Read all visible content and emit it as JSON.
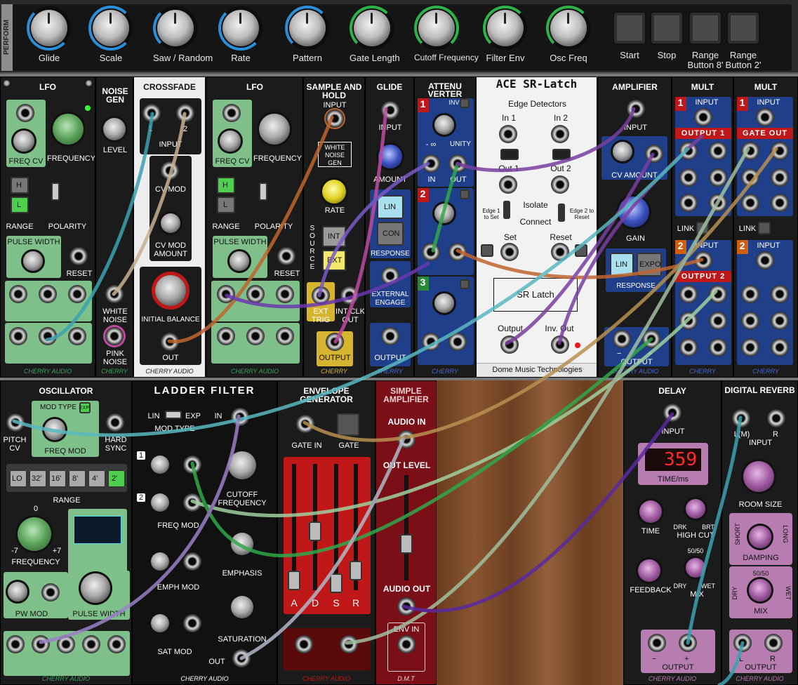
{
  "perform": {
    "tab_label": "PERFORM",
    "knobs": [
      {
        "label": "Glide",
        "color": "#2a8fd8"
      },
      {
        "label": "Scale",
        "color": "#2a8fd8"
      },
      {
        "label": "Saw / Random",
        "color": "#2a8fd8"
      },
      {
        "label": "Rate",
        "color": "#2a8fd8"
      },
      {
        "label": "Pattern",
        "color": "#2a8fd8"
      },
      {
        "label": "Gate Length",
        "color": "#2db34a"
      },
      {
        "label": "Cutoff Frequency",
        "color": "#2db34a"
      },
      {
        "label": "Filter Env",
        "color": "#2db34a"
      },
      {
        "label": "Osc Freq",
        "color": "#2db34a"
      }
    ],
    "buttons": [
      {
        "label": "Start"
      },
      {
        "label": "Stop"
      },
      {
        "label": "Range Button 8'"
      },
      {
        "label": "Range Button 2'"
      }
    ]
  },
  "lfo1": {
    "title": "LFO",
    "freq_cv": "FREQ CV",
    "frequency": "FREQUENCY",
    "h": "H",
    "l": "L",
    "range": "RANGE",
    "polarity": "POLARITY",
    "pulse_width": "PULSE WIDTH",
    "reset": "RESET",
    "brand": "CHERRY AUDIO"
  },
  "noise": {
    "title": "NOISE GEN",
    "level": "LEVEL",
    "white": "WHITE NOISE",
    "pink": "PINK NOISE",
    "brand": "CHERRY"
  },
  "crossfade": {
    "title": "CROSSFADE",
    "in1": "1",
    "in2": "2",
    "input": "INPUT",
    "cv_mod": "CV MOD",
    "cv_mod_amount": "CV MOD AMOUNT",
    "initial_balance": "INITIAL BALANCE",
    "out": "OUT",
    "brand": "CHERRY AUDIO"
  },
  "lfo2": {
    "title": "LFO",
    "freq_cv": "FREQ CV",
    "frequency": "FREQUENCY",
    "h": "H",
    "l": "L",
    "range": "RANGE",
    "polarity": "POLARITY",
    "pulse_width": "PULSE WIDTH",
    "reset": "RESET",
    "brand": "CHERRY AUDIO"
  },
  "sh": {
    "title": "SAMPLE AND HOLD",
    "input": "INPUT",
    "white_noise_gen": "WHITE NOISE GEN",
    "rate": "RATE",
    "source": "SOURCE",
    "int": "INT",
    "ext": "EXT",
    "ext_trig": "EXT TRIG",
    "int_clk_out": "INT CLK OUT",
    "output": "OUTPUT",
    "brand": "CHERRY"
  },
  "glide": {
    "title": "GLIDE",
    "input": "INPUT",
    "amount": "AMOUNT",
    "lin": "LIN",
    "con": "CON",
    "response": "RESPONSE",
    "external_engage": "EXTERNAL ENGAGE",
    "output": "OUTPUT",
    "brand": "CHERRY"
  },
  "attenuverter": {
    "title": "ATTENU VERTER",
    "inv": "INV",
    "minus_inf": "- ∞",
    "unity": "UNITY",
    "in": "IN",
    "out": "OUT",
    "ch1": "1",
    "ch2": "2",
    "ch3": "3",
    "brand": "CHERRY"
  },
  "latch": {
    "title": "ACE SR-Latch",
    "edge_detectors": "Edge Detectors",
    "in1": "In 1",
    "in2": "In 2",
    "out1": "Out 1",
    "out2": "Out 2",
    "isolate": "Isolate",
    "connect": "Connect",
    "edge1": "Edge 1 to Set",
    "edge2": "Edge 2 to Reset",
    "set": "Set",
    "reset": "Reset",
    "sr_latch": "SR Latch",
    "output": "Output",
    "inv_out": "Inv. Out",
    "brand": "Dome Music Technologies"
  },
  "amplifier": {
    "title": "AMPLIFIER",
    "input": "INPUT",
    "cv_amount": "CV AMOUNT",
    "gain": "GAIN",
    "lin": "LIN",
    "expo": "EXPO",
    "response": "RESPONSE",
    "minus": "−",
    "plus": "+",
    "output": "OUTPUT",
    "brand": "CHERRY AUDIO"
  },
  "mult1": {
    "title": "MULT",
    "ch1": "1",
    "ch2": "2",
    "input": "INPUT",
    "output1": "OUTPUT 1",
    "output2": "OUTPUT 2",
    "link": "LINK",
    "brand": "CHERRY"
  },
  "mult2": {
    "title": "MULT",
    "ch1": "1",
    "ch2": "2",
    "input": "INPUT",
    "gate_out": "GATE OUT",
    "link": "LINK",
    "brand": "CHERRY"
  },
  "osc": {
    "title": "OSCILLATOR",
    "mod_type": "MOD TYPE",
    "exp": "EXP",
    "pitch_cv": "PITCH CV",
    "freq_mod": "FREQ MOD",
    "hard_sync": "HARD SYNC",
    "ranges": [
      "LO",
      "32'",
      "16'",
      "8'",
      "4'",
      "2'"
    ],
    "range": "RANGE",
    "zero": "0",
    "minus7": "-7",
    "plus7": "+7",
    "frequency": "FREQUENCY",
    "pw_mod": "PW MOD",
    "pulse_width": "PULSE WIDTH",
    "brand": "CHERRY AUDIO"
  },
  "ladder": {
    "title": "LADDER FILTER",
    "lin": "LIN",
    "exp": "EXP",
    "mod_type": "MOD TYPE",
    "in": "IN",
    "n1": "1",
    "n2": "2",
    "freq_mod": "FREQ MOD",
    "cutoff_frequency": "CUTOFF FREQUENCY",
    "emph_mod": "EMPH MOD",
    "emphasis": "EMPHASIS",
    "sat_mod": "SAT MOD",
    "saturation": "SATURATION",
    "out": "OUT",
    "brand": "CHERRY AUDIO"
  },
  "env": {
    "title": "ENVELOPE GENERATOR",
    "gate_in": "GATE IN",
    "gate": "GATE",
    "a": "A",
    "d": "D",
    "s": "S",
    "r": "R",
    "brand": "CHERRY AUDIO"
  },
  "simpleamp": {
    "title": "SIMPLE AMPLIFIER",
    "audio_in": "AUDIO IN",
    "out_level": "OUT LEVEL",
    "audio_out": "AUDIO OUT",
    "env_in": "ENV IN",
    "brand": "D.M.T"
  },
  "delay": {
    "title": "DELAY",
    "input": "INPUT",
    "display": "359",
    "time_ms": "TIME/ms",
    "time": "TIME",
    "drk": "DRK",
    "brt": "BRT",
    "high_cut": "HIGH CUT",
    "feedback": "FEEDBACK",
    "fifty": "50/50",
    "dry": "DRY",
    "wet": "WET",
    "mix": "MIX",
    "minus": "−",
    "plus": "+",
    "output": "OUTPUT",
    "brand": "CHERRY AUDIO"
  },
  "reverb": {
    "title": "DIGITAL REVERB",
    "lm": "L(M)",
    "r": "R",
    "input": "INPUT",
    "room_size": "ROOM SIZE",
    "short": "SHORT",
    "long": "LONG",
    "damping": "DAMPING",
    "fifty": "50/50",
    "dry": "DRY",
    "wet": "WET",
    "mix": "MIX",
    "l": "L",
    "r2": "R",
    "output": "OUTPUT",
    "brand": "CHERRY AUDIO"
  },
  "colors": {
    "cable_teal": "#3aa3b0",
    "cable_purple": "#7a3fa0",
    "cable_green": "#2fa84a",
    "cable_orange": "#c0652f",
    "cable_blue": "#3048b8",
    "cable_tan": "#b89050",
    "cable_pink": "#c04aa0"
  }
}
